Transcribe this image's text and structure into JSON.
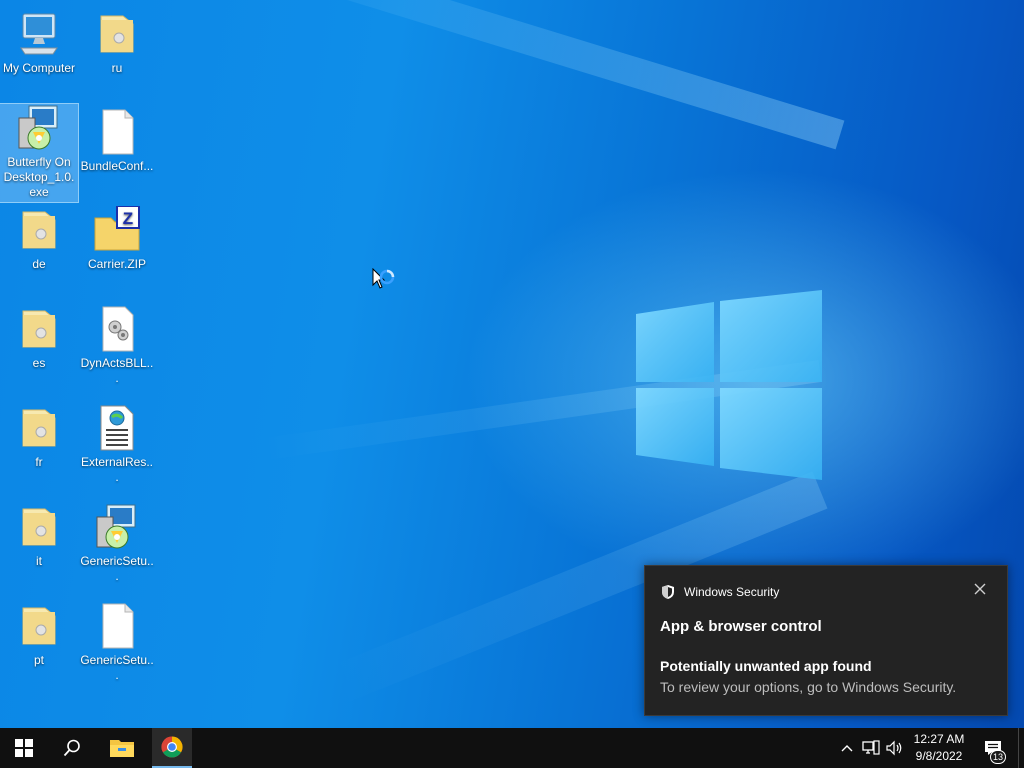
{
  "desktop": {
    "icons": [
      {
        "label": "My Computer",
        "icon": "computer-icon"
      },
      {
        "label": "ru",
        "icon": "folder-icon"
      },
      {
        "label": "Butterfly On Desktop_1.0.exe",
        "icon": "installer-icon",
        "selected": true
      },
      {
        "label": "BundleConf...",
        "icon": "file-icon"
      },
      {
        "label": "de",
        "icon": "folder-icon"
      },
      {
        "label": "Carrier.ZIP",
        "icon": "zip-folder-icon"
      },
      {
        "label": "es",
        "icon": "folder-icon"
      },
      {
        "label": "DynActsBLL...",
        "icon": "dll-file-icon"
      },
      {
        "label": "fr",
        "icon": "folder-icon"
      },
      {
        "label": "ExternalRes...",
        "icon": "web-document-icon"
      },
      {
        "label": "it",
        "icon": "folder-icon"
      },
      {
        "label": "GenericSetu...",
        "icon": "installer-icon"
      },
      {
        "label": "pt",
        "icon": "folder-icon"
      },
      {
        "label": "GenericSetu...",
        "icon": "file-icon"
      }
    ]
  },
  "toast": {
    "app_name": "Windows Security",
    "title": "App & browser control",
    "subtitle": "Potentially unwanted app found",
    "body": "To review your options, go to Windows Security."
  },
  "taskbar": {
    "apps": [
      "start-icon",
      "search-icon",
      "file-explorer-icon",
      "chrome-icon"
    ],
    "clock_time": "12:27 AM",
    "clock_date": "9/8/2022",
    "notification_count": "13"
  },
  "colors": {
    "toast_bg": "#232323",
    "taskbar_bg": "#101010",
    "accent": "#76b9ed"
  }
}
